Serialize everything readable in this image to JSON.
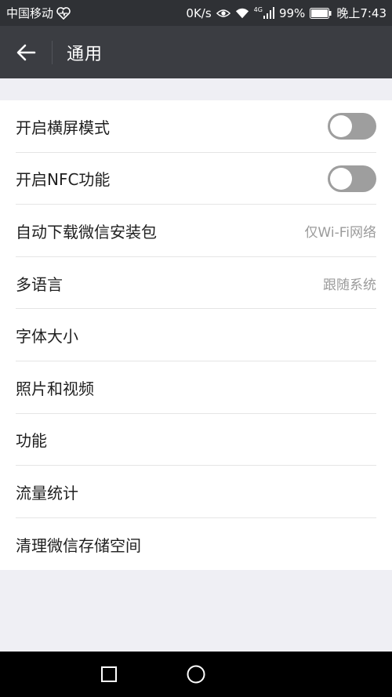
{
  "status_bar": {
    "carrier": "中国移动",
    "speed": "0K/s",
    "network": "4G",
    "battery": "99%",
    "time": "晚上7:43"
  },
  "header": {
    "title": "通用"
  },
  "settings": {
    "items": [
      {
        "label": "开启横屏模式",
        "type": "toggle",
        "on": false
      },
      {
        "label": "开启NFC功能",
        "type": "toggle",
        "on": false
      },
      {
        "label": "自动下载微信安装包",
        "value": "仅Wi-Fi网络"
      },
      {
        "label": "多语言",
        "value": "跟随系统"
      },
      {
        "label": "字体大小"
      },
      {
        "label": "照片和视频"
      },
      {
        "label": "功能"
      },
      {
        "label": "流量统计"
      },
      {
        "label": "清理微信存储空间"
      }
    ]
  },
  "icons": {
    "heart": "heart-icon",
    "eye": "eye-icon",
    "wifi": "wifi-icon",
    "signal": "signal-icon",
    "battery": "battery-icon",
    "back": "back-arrow-icon",
    "recent_apps": "square-icon",
    "home": "circle-icon"
  },
  "colors": {
    "status_bar": "#2f3135",
    "title_bar": "#3b3d42",
    "background": "#efeff4",
    "toggle_off": "#9e9e9e"
  }
}
